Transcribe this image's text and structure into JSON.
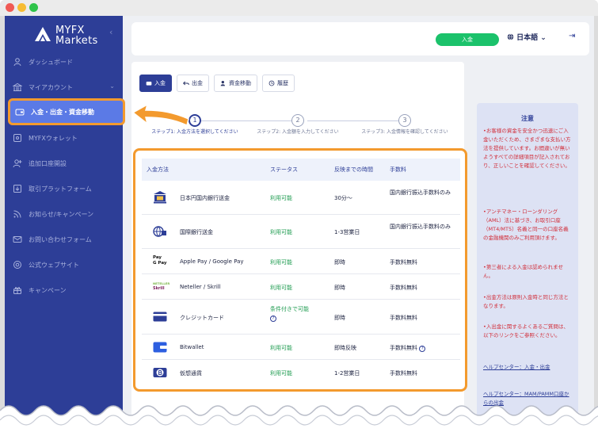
{
  "logo": {
    "line1": "MYFX",
    "line2": "Markets"
  },
  "sidebar": {
    "collapse_icon": "‹",
    "items": [
      {
        "label": "ダッシュボード",
        "icon": "user-icon"
      },
      {
        "label": "マイアカウント",
        "icon": "bank-icon",
        "chevron": "⌄"
      },
      {
        "label": "入金・出金・資金移動",
        "icon": "wallet-icon",
        "active": true
      },
      {
        "label": "MYFXウォレット",
        "icon": "wallet-alt-icon"
      },
      {
        "label": "追加口座開設",
        "icon": "user-plus-icon"
      },
      {
        "label": "取引プラットフォーム",
        "icon": "download-icon"
      },
      {
        "label": "お知らせ/キャンペーン",
        "icon": "rss-icon"
      },
      {
        "label": "お問い合わせフォーム",
        "icon": "mail-icon"
      },
      {
        "label": "公式ウェブサイト",
        "icon": "globe-icon"
      },
      {
        "label": "キャンペーン",
        "icon": "gift-icon"
      }
    ]
  },
  "topbar": {
    "deposit_label": "入金",
    "language_label": "日本語",
    "language_chevron": "⌄",
    "logout_icon": "⇥"
  },
  "tabs": [
    {
      "label": "入金",
      "icon": "wallet-icon"
    },
    {
      "label": "出金",
      "icon": "undo-icon"
    },
    {
      "label": "資金移動",
      "icon": "transfer-icon"
    },
    {
      "label": "履歴",
      "icon": "history-icon"
    }
  ],
  "stepper": [
    {
      "num": "1",
      "label": "ステップ1: 入金方法を選択してください"
    },
    {
      "num": "2",
      "label": "ステップ2: 入金額を入力してください"
    },
    {
      "num": "3",
      "label": "ステップ3: 入金情報を確認してください"
    }
  ],
  "methods": {
    "headers": {
      "method": "入金方法",
      "status": "ステータス",
      "time": "反映までの時間",
      "fee": "手数料"
    },
    "rows": [
      {
        "icon": "domestic-bank-icon",
        "name": "日本円国内銀行送金",
        "status": "利用可能",
        "time": "30分～",
        "fee": "国内銀行振込手数料のみ"
      },
      {
        "icon": "international-bank-icon",
        "name": "国際銀行送金",
        "status": "利用可能",
        "time": "1-3営業日",
        "fee": "国内銀行振込手数料のみ"
      },
      {
        "icon": "apple-google-pay-icon",
        "name": "Apple Pay / Google Pay",
        "status": "利用可能",
        "time": "即時",
        "fee": "手数料無料",
        "icon_text": [
          "Pay",
          "G Pay"
        ]
      },
      {
        "icon": "neteller-skrill-icon",
        "name": "Neteller / Skrill",
        "status": "利用可能",
        "time": "即時",
        "fee": "手数料無料",
        "icon_text": [
          "NETELLER",
          "Skrill"
        ]
      },
      {
        "icon": "credit-card-icon",
        "name": "クレジットカード",
        "status": "条件付きで可能",
        "time": "即時",
        "fee": "手数料無料",
        "status_help": "?"
      },
      {
        "icon": "bitwallet-icon",
        "name": "Bitwallet",
        "status": "利用可能",
        "time": "即時反映",
        "fee": "手数料無料",
        "fee_help": "?"
      },
      {
        "icon": "crypto-icon",
        "name": "仮想通貨",
        "status": "利用可能",
        "time": "1-2営業日",
        "fee": "手数料無料"
      }
    ]
  },
  "notice": {
    "title": "注意",
    "paragraphs": [
      "•お客様の資金を安全かつ迅速にご入金いただくため、さまざまな支払い方法を提供しています。お間違いが無いようすべての詳細項目が記入されており、正しいことを確認してください。",
      "•アンチマネー・ローンダリング（AML）法に基づき、お取引口座（MT4/MT5）名義と同一の口座名義の金融機関のみご利用頂けます。",
      "•第三者による入金は認められません。",
      "•出金方法は原則入金時と同じ方法となります。",
      "•入出金に関するよくあるご質問は、以下のリンクをご参照ください。"
    ],
    "links": [
      "ヘルプセンター：入金・出金",
      "ヘルプセンター：MAM/PAMM口座からの出金"
    ]
  },
  "colors": {
    "sidebar": "#2d3e97",
    "highlight": "#f39a2e",
    "available": "#1d9b4f",
    "deposit_pill": "#1bc26b",
    "notice_text": "#d12e3a"
  }
}
